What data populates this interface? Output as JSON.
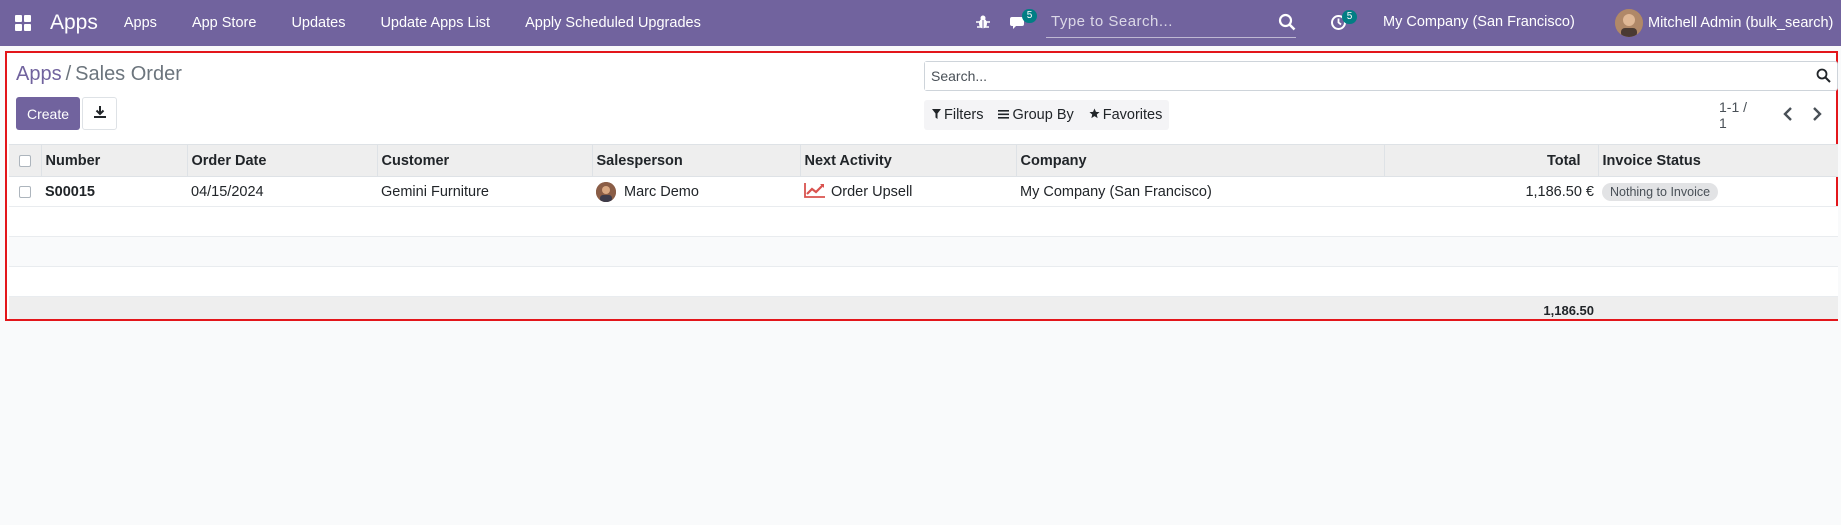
{
  "navbar": {
    "brand": "Apps",
    "menu": [
      "Apps",
      "App Store",
      "Updates",
      "Update Apps List",
      "Apply Scheduled Upgrades"
    ],
    "messages_badge": "5",
    "activities_badge": "5",
    "search_placeholder": "Type to Search...",
    "company": "My Company (San Francisco)",
    "user": "Mitchell Admin (bulk_search)"
  },
  "breadcrumb": {
    "parent": "Apps",
    "separator": "/",
    "current": "Sales Order"
  },
  "buttons": {
    "create": "Create"
  },
  "search": {
    "placeholder": "Search..."
  },
  "filters": {
    "filters": "Filters",
    "group_by": "Group By",
    "favorites": "Favorites"
  },
  "pager": {
    "value": "1-1 / 1"
  },
  "table": {
    "columns": {
      "number": "Number",
      "order_date": "Order Date",
      "customer": "Customer",
      "salesperson": "Salesperson",
      "next_activity": "Next Activity",
      "company": "Company",
      "total": "Total",
      "invoice_status": "Invoice Status"
    },
    "rows": [
      {
        "number": "S00015",
        "order_date": "04/15/2024",
        "customer": "Gemini Furniture",
        "salesperson": "Marc Demo",
        "next_activity": "Order Upsell",
        "company": "My Company (San Francisco)",
        "total": "1,186.50 €",
        "invoice_status": "Nothing to Invoice"
      }
    ],
    "footer_total": "1,186.50"
  },
  "colors": {
    "brand": "#71639e",
    "badge": "#017e84",
    "highlight_border": "#e3161b",
    "activity_icon": "#d9534f"
  },
  "icons": [
    "apps-grid-icon",
    "bug-icon",
    "chat-icon",
    "search-icon",
    "clock-icon",
    "download-icon",
    "filter-icon",
    "group-by-icon",
    "star-icon",
    "chevron-left-icon",
    "chevron-right-icon",
    "trend-chart-icon"
  ]
}
